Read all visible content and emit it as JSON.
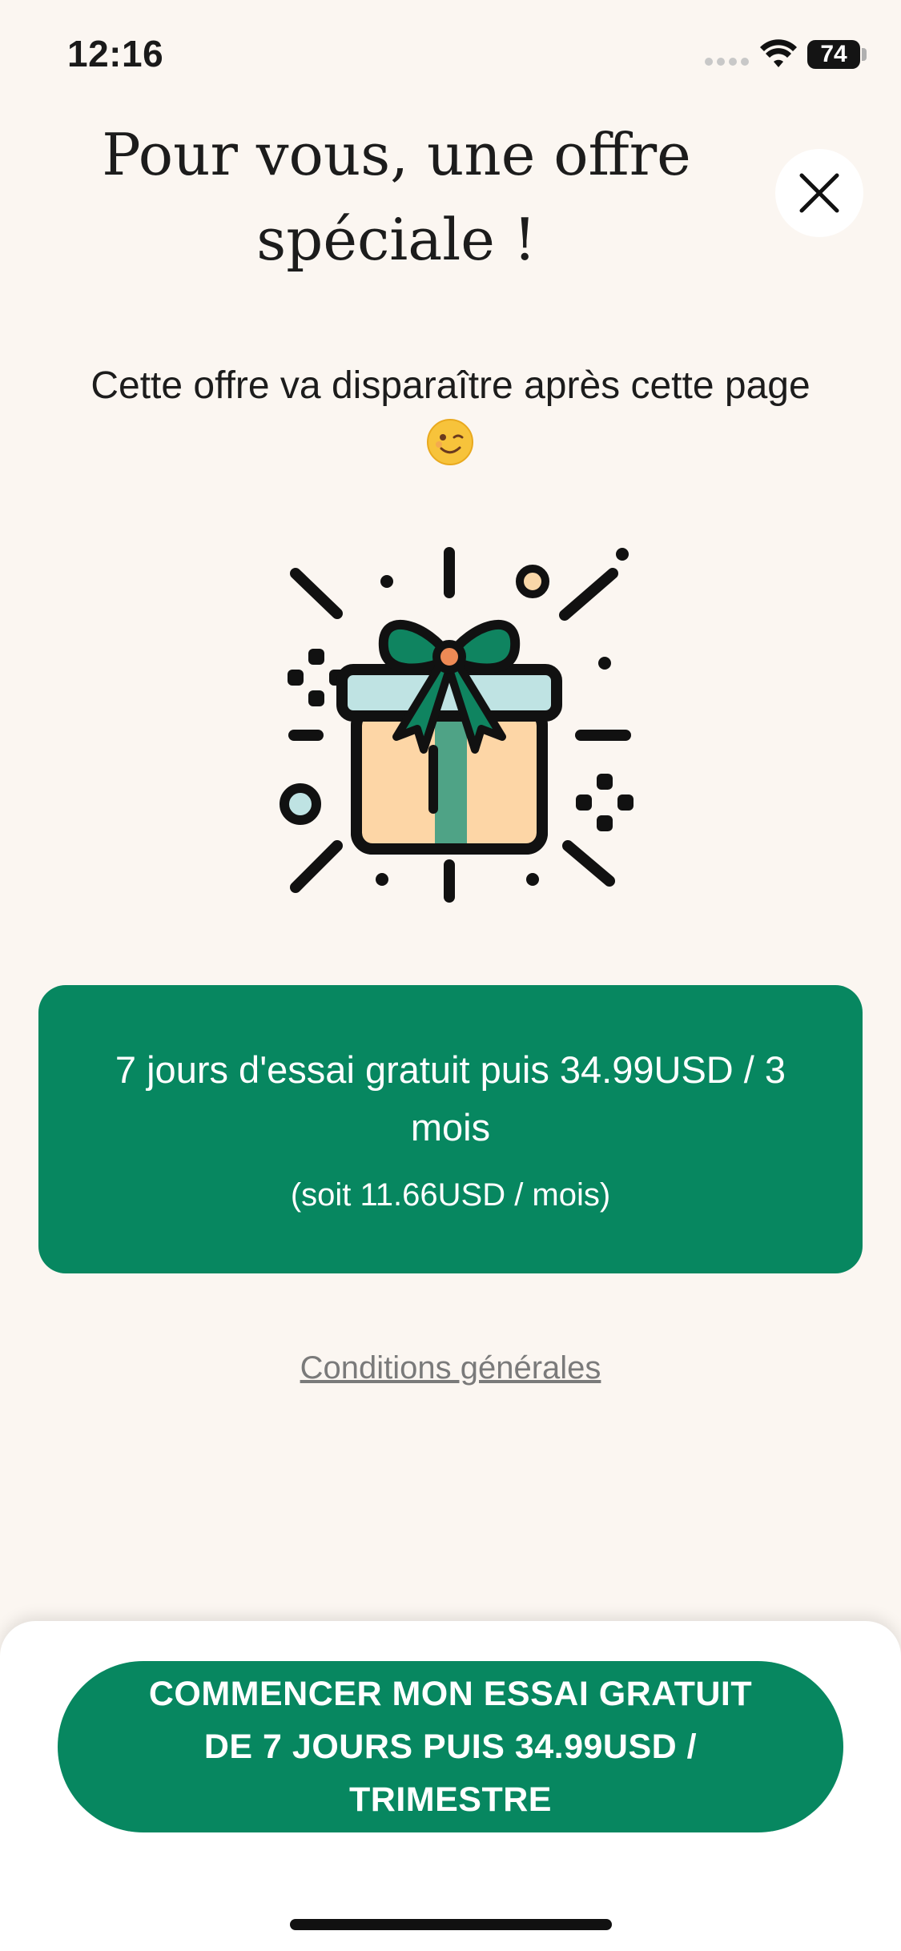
{
  "status_bar": {
    "time": "12:16",
    "battery": "74"
  },
  "header": {
    "title": "Pour vous, une offre spéciale !"
  },
  "subtitle": "Cette offre va disparaître après cette page",
  "emoji": "winking-face",
  "illustration": "gift-box-icon",
  "offer": {
    "main": "7 jours d'essai gratuit puis 34.99USD / 3 mois",
    "sub": "(soit 11.66USD / mois)"
  },
  "terms_link": "Conditions générales",
  "cta": {
    "label": "COMMENCER MON ESSAI GRATUIT DE 7 JOURS PUIS 34.99USD / TRIMESTRE"
  },
  "colors": {
    "background": "#FBF6F1",
    "brand_green": "#078760",
    "sheet": "#FFFFFF"
  }
}
